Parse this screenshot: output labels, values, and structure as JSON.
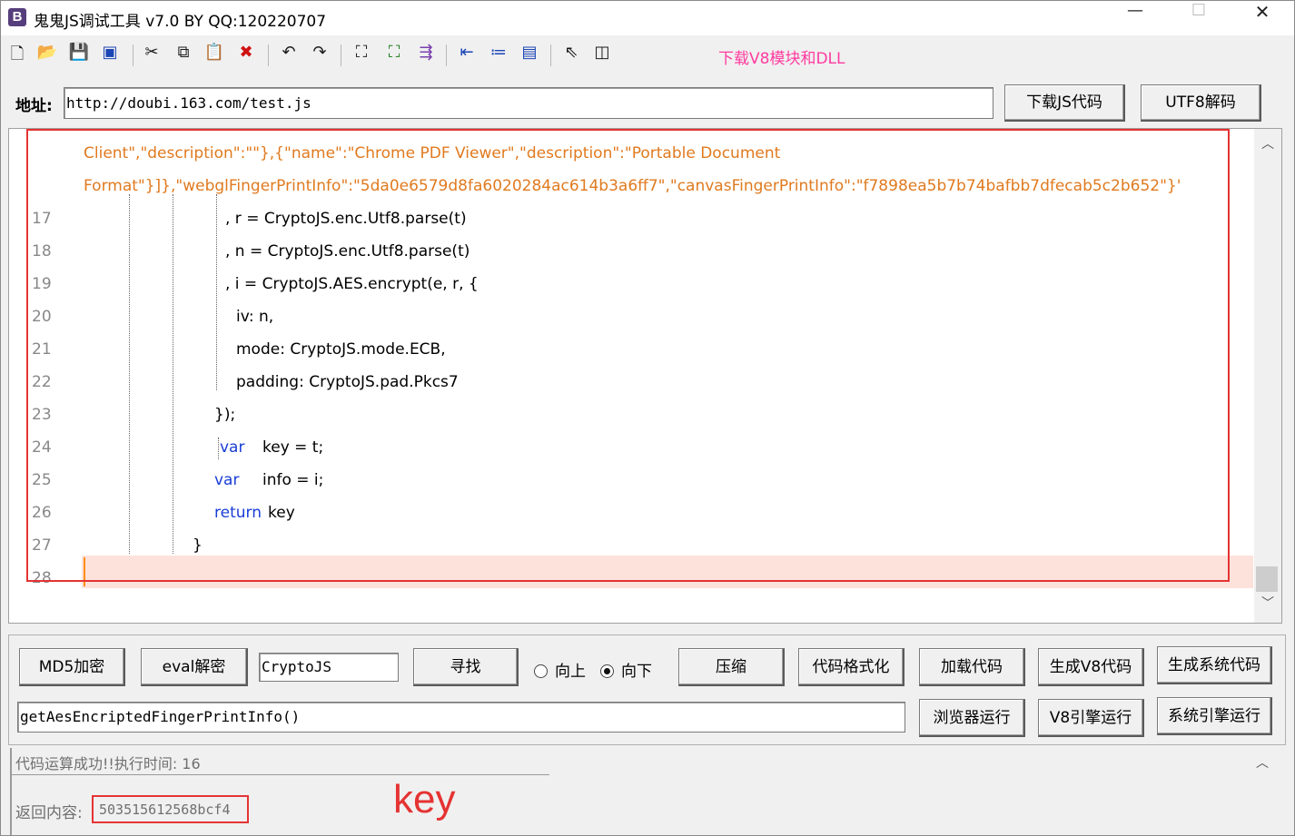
{
  "window": {
    "title": "鬼鬼JS调试工具 v7.0 BY QQ:120220707",
    "icon_letter": "B",
    "min": "—",
    "max": "☐",
    "close": "✕"
  },
  "toolbar": {
    "icons": [
      "new-file-icon",
      "open-folder-icon",
      "save-icon",
      "save-all-icon",
      "cut-icon",
      "copy-icon",
      "paste-icon",
      "delete-icon",
      "undo-icon",
      "redo-icon",
      "find-icon",
      "find-next-icon",
      "indent-icon",
      "outdent-icon",
      "numbered-list-icon",
      "window-icon",
      "help-pointer-icon",
      "panel-icon"
    ],
    "download_link": "下载V8模块和DLL"
  },
  "address": {
    "label": "地址:",
    "url": "http://doubi.163.com/test.js",
    "download_js": "下载JS代码",
    "utf8_decode": "UTF8解码"
  },
  "editor": {
    "lines": [
      {
        "num": "",
        "text": "Client\",\"description\":\"\"},{\"name\":\"Chrome PDF Viewer\",\"description\":\"Portable Document"
      },
      {
        "num": "",
        "text": "Format\"}]},\"webglFingerPrintInfo\":\"5da0e6579d8fa6020284ac614b3a6ff7\",\"canvasFingerPrintInfo\":\"f7898ea5b7b74bafbb7dfecab5c2b652\"}'"
      },
      {
        "num": "17",
        "text": ", r = CryptoJS.enc.Utf8.parse(t)"
      },
      {
        "num": "18",
        "text": ", n = CryptoJS.enc.Utf8.parse(t)"
      },
      {
        "num": "19",
        "text": ", i = CryptoJS.AES.encrypt(e, r, {"
      },
      {
        "num": "20",
        "text": "iv: n,"
      },
      {
        "num": "21",
        "text": "mode: CryptoJS.mode.ECB,"
      },
      {
        "num": "22",
        "text": "padding: CryptoJS.pad.Pkcs7"
      },
      {
        "num": "23",
        "text": "});"
      },
      {
        "num": "24",
        "kw": "var",
        "text": "key = t;"
      },
      {
        "num": "25",
        "kw": "var",
        "text": "info = i;"
      },
      {
        "num": "26",
        "kw": "return",
        "text": "key"
      },
      {
        "num": "27",
        "text": "}"
      },
      {
        "num": "28",
        "text": ""
      }
    ]
  },
  "controls": {
    "md5": "MD5加密",
    "eval_decode": "eval解密",
    "search_value": "CryptoJS",
    "find": "寻找",
    "radio_up": "向上",
    "radio_down": "向下",
    "compress": "压缩",
    "format": "代码格式化",
    "load_code": "加载代码",
    "gen_v8": "生成V8代码",
    "gen_system": "生成系统代码",
    "expression_value": "getAesEncriptedFingerPrintInfo()",
    "browser_run": "浏览器运行",
    "v8_run": "V8引擎运行",
    "system_run": "系统引擎运行"
  },
  "output": {
    "status": "代码运算成功!!执行时间: 16",
    "label": "返回内容:",
    "value": "503515612568bcf4",
    "annotation": "key"
  }
}
